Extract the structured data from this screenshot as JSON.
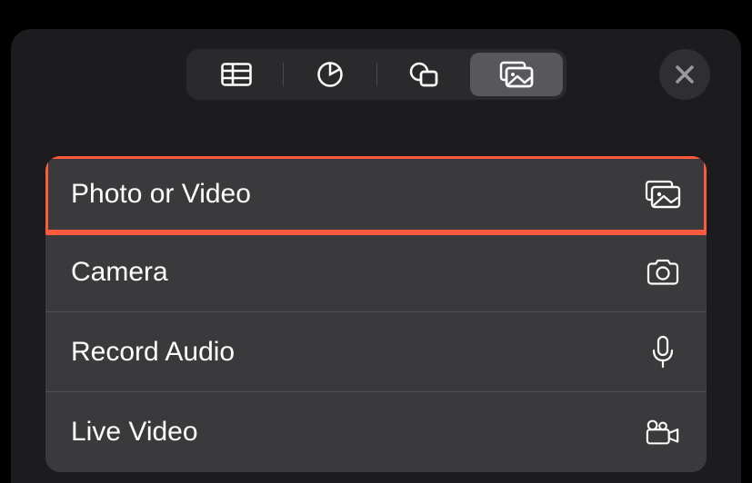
{
  "toolbar": {
    "tabs": [
      {
        "name": "table",
        "active": false
      },
      {
        "name": "chart",
        "active": false
      },
      {
        "name": "shapes",
        "active": false
      },
      {
        "name": "media",
        "active": true
      }
    ]
  },
  "menu": {
    "items": [
      {
        "label": "Photo or Video",
        "icon": "media"
      },
      {
        "label": "Camera",
        "icon": "camera"
      },
      {
        "label": "Record Audio",
        "icon": "mic"
      },
      {
        "label": "Live Video",
        "icon": "video-camera"
      }
    ]
  },
  "highlight_index": 0
}
